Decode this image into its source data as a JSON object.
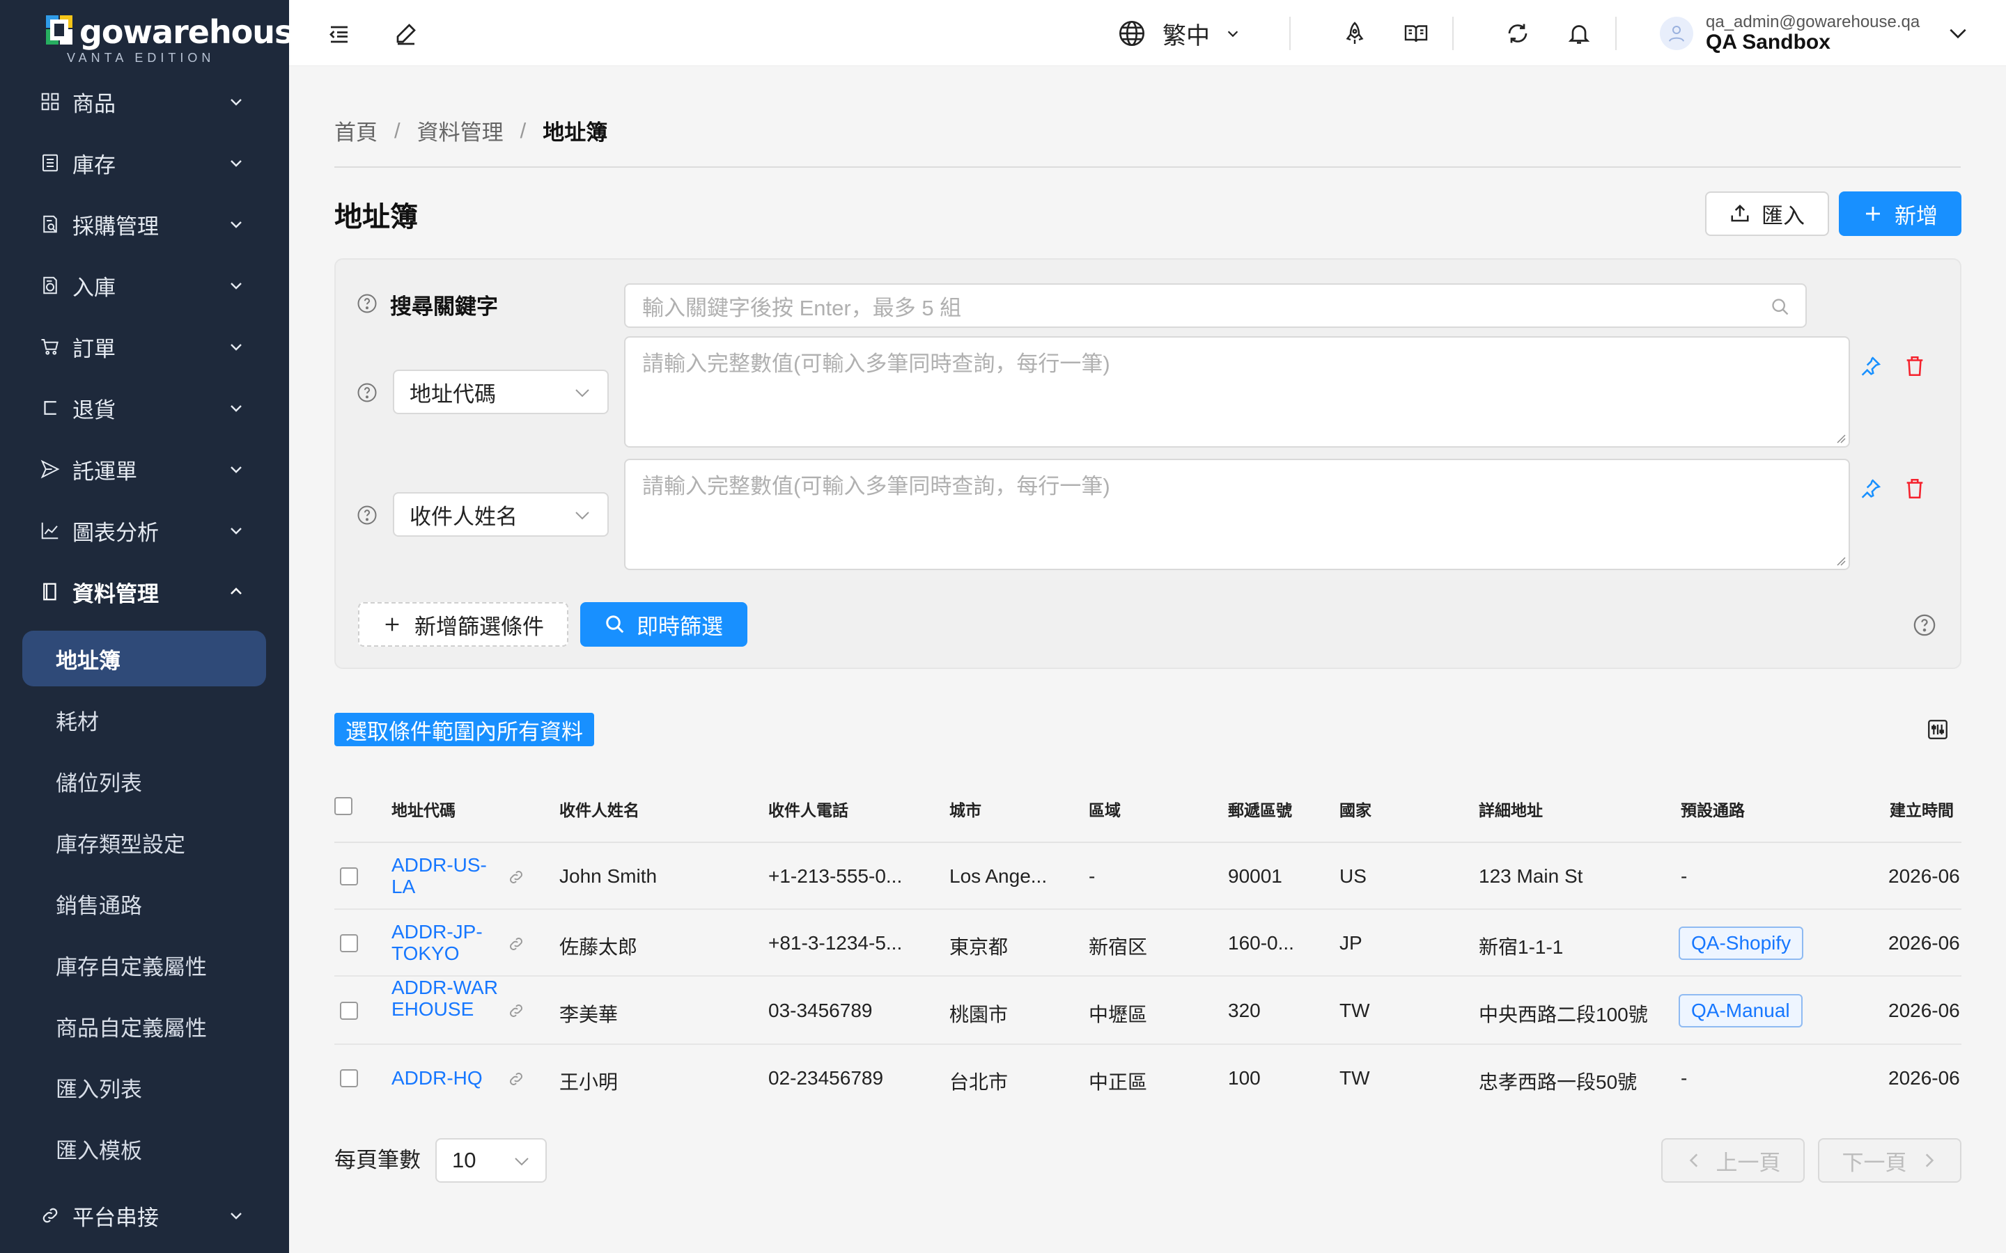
{
  "app": {
    "logo_text": "gowarehouse",
    "logo_sub": "VANTA EDITION"
  },
  "sidebar": {
    "items": [
      {
        "label": "商品",
        "icon": "grid-icon"
      },
      {
        "label": "庫存",
        "icon": "list-box-icon"
      },
      {
        "label": "採購管理",
        "icon": "doc-search-icon"
      },
      {
        "label": "入庫",
        "icon": "doc-inbound-icon"
      },
      {
        "label": "訂單",
        "icon": "cart-icon"
      },
      {
        "label": "退貨",
        "icon": "return-icon"
      },
      {
        "label": "託運單",
        "icon": "send-icon"
      },
      {
        "label": "圖表分析",
        "icon": "line-chart-icon"
      },
      {
        "label": "資料管理",
        "icon": "book-icon"
      }
    ],
    "sub_items": [
      "地址簿",
      "耗材",
      "儲位列表",
      "庫存類型設定",
      "銷售通路",
      "庫存自定義屬性",
      "商品自定義屬性",
      "匯入列表",
      "匯入模板"
    ],
    "bottom_item": {
      "label": "平台串接",
      "icon": "link-icon"
    }
  },
  "header": {
    "language": "繁中",
    "user_email": "qa_admin@gowarehouse.qa",
    "user_org": "QA Sandbox"
  },
  "breadcrumb": {
    "home": "首頁",
    "section": "資料管理",
    "current": "地址簿",
    "separator": "/"
  },
  "page": {
    "title": "地址簿",
    "import_label": "匯入",
    "add_label": "新增"
  },
  "filter": {
    "keyword_label": "搜尋關鍵字",
    "keyword_placeholder": "輸入關鍵字後按 Enter，最多 5 組",
    "conditions": [
      {
        "field": "地址代碼",
        "placeholder": "請輸入完整數值(可輸入多筆同時查詢，每行一筆)"
      },
      {
        "field": "收件人姓名",
        "placeholder": "請輸入完整數值(可輸入多筆同時查詢，每行一筆)"
      }
    ],
    "add_condition_label": "新增篩選條件",
    "live_filter_label": "即時篩選"
  },
  "select_all_label": "選取條件範圍內所有資料",
  "table": {
    "columns": [
      "地址代碼",
      "收件人姓名",
      "收件人電話",
      "城市",
      "區域",
      "郵遞區號",
      "國家",
      "詳細地址",
      "預設通路",
      "建立時間"
    ],
    "rows": [
      {
        "code": "ADDR-US-LA",
        "name": "John Smith",
        "phone": "+1-213-555-0...",
        "city": "Los Ange...",
        "district": "-",
        "zip": "90001",
        "country": "US",
        "address": "123 Main St",
        "channel": "-",
        "created": "2026-06"
      },
      {
        "code": "ADDR-JP-TOKYO",
        "name": "佐藤太郎",
        "phone": "+81-3-1234-5...",
        "city": "東京都",
        "district": "新宿区",
        "zip": "160-0...",
        "country": "JP",
        "address": "新宿1-1-1",
        "channel": "QA-Shopify",
        "created": "2026-06"
      },
      {
        "code": "ADDR-WAREHOUSE",
        "name": "李美華",
        "phone": "03-3456789",
        "city": "桃園市",
        "district": "中壢區",
        "zip": "320",
        "country": "TW",
        "address": "中央西路二段100號",
        "channel": "QA-Manual",
        "created": "2026-06"
      },
      {
        "code": "ADDR-HQ",
        "name": "王小明",
        "phone": "02-23456789",
        "city": "台北市",
        "district": "中正區",
        "zip": "100",
        "country": "TW",
        "address": "忠孝西路一段50號",
        "channel": "-",
        "created": "2026-06"
      }
    ]
  },
  "pagination": {
    "per_page_label": "每頁筆數",
    "per_page_value": "10",
    "prev_label": "上一頁",
    "next_label": "下一頁"
  },
  "colors": {
    "sidebar_bg": "#1e293b",
    "sidebar_selected": "#2f4a78",
    "primary": "#1890ff",
    "link": "#1677ff",
    "danger": "#f5222d"
  }
}
